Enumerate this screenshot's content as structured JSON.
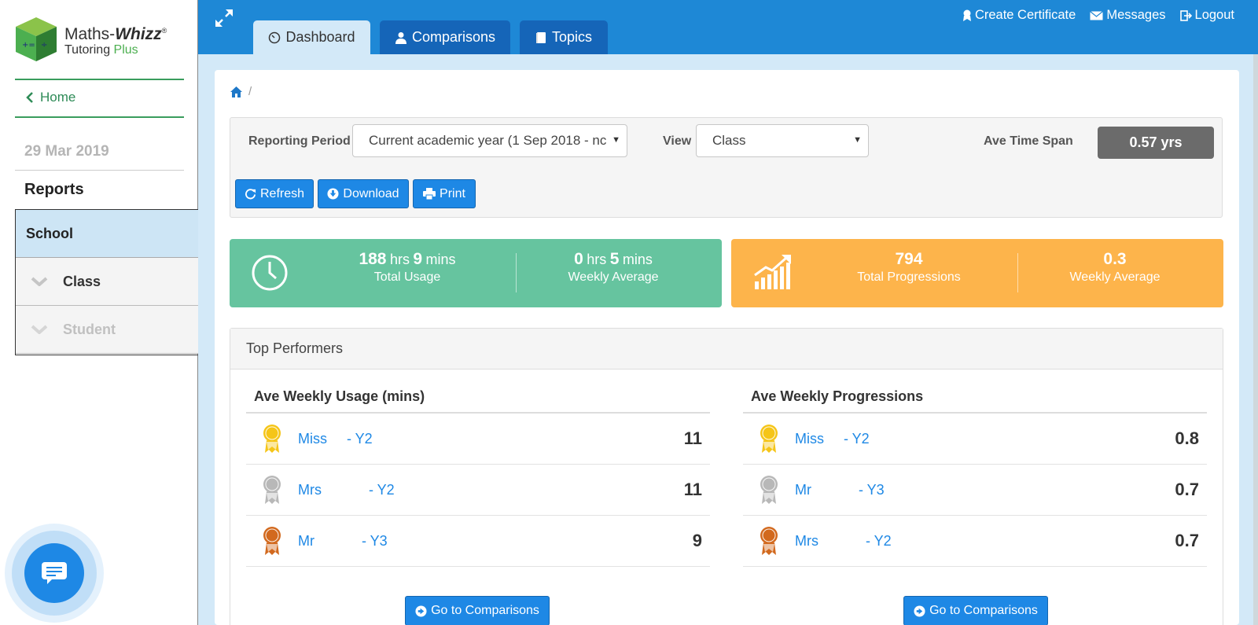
{
  "brand": {
    "name_part1": "Maths-",
    "name_part2": "Whizz",
    "reg": "®",
    "tag_part1": "Tutoring ",
    "tag_part2": "Plus"
  },
  "sidebar": {
    "home_label": "Home",
    "date": "29 Mar 2019",
    "reports_heading": "Reports",
    "nav": [
      {
        "label": "School"
      },
      {
        "label": "Class"
      },
      {
        "label": "Student"
      }
    ]
  },
  "tabs": [
    {
      "label": "Dashboard",
      "icon": "dashboard-icon"
    },
    {
      "label": "Comparisons",
      "icon": "user-icon"
    },
    {
      "label": "Topics",
      "icon": "book-icon"
    }
  ],
  "top_links": {
    "certificate": "Create Certificate",
    "messages": "Messages",
    "logout": "Logout"
  },
  "breadcrumb": {
    "separator": "/"
  },
  "filters": {
    "period_label": "Reporting Period",
    "period_value": "Current academic year (1 Sep 2018 - nc",
    "view_label": "View",
    "view_value": "Class",
    "avetime_label": "Ave Time Span",
    "avetime_value": "0.57 yrs"
  },
  "buttons": {
    "refresh": "Refresh",
    "download": "Download",
    "print": "Print"
  },
  "usage": {
    "total_hrs": "188",
    "total_mins": "9",
    "total_label": "Total Usage",
    "weekly_hrs": "0",
    "weekly_mins": "5",
    "weekly_label": "Weekly Average",
    "hrs_unit": "hrs",
    "mins_unit": "mins"
  },
  "progress": {
    "total": "794",
    "total_label": "Total Progressions",
    "weekly": "0.3",
    "weekly_label": "Weekly Average"
  },
  "top_performers": {
    "title": "Top Performers",
    "usage_title": "Ave Weekly Usage (mins)",
    "progress_title": "Ave Weekly Progressions",
    "usage_rows": [
      {
        "name": "Miss     - Y2",
        "value": "11",
        "medal": "gold"
      },
      {
        "name": "Mrs            - Y2",
        "value": "11",
        "medal": "silver"
      },
      {
        "name": "Mr            - Y3",
        "value": "9",
        "medal": "bronze"
      }
    ],
    "progress_rows": [
      {
        "name": "Miss     - Y2",
        "value": "0.8",
        "medal": "gold"
      },
      {
        "name": "Mr            - Y3",
        "value": "0.7",
        "medal": "silver"
      },
      {
        "name": "Mrs            - Y2",
        "value": "0.7",
        "medal": "bronze"
      }
    ],
    "go_label": "Go to Comparisons"
  },
  "colors": {
    "primary": "#1e88e5",
    "green_card": "#66c49f",
    "orange_card": "#fdb44b",
    "gold": "#f5c518",
    "silver": "#b8b8b8",
    "bronze": "#d2691e"
  }
}
